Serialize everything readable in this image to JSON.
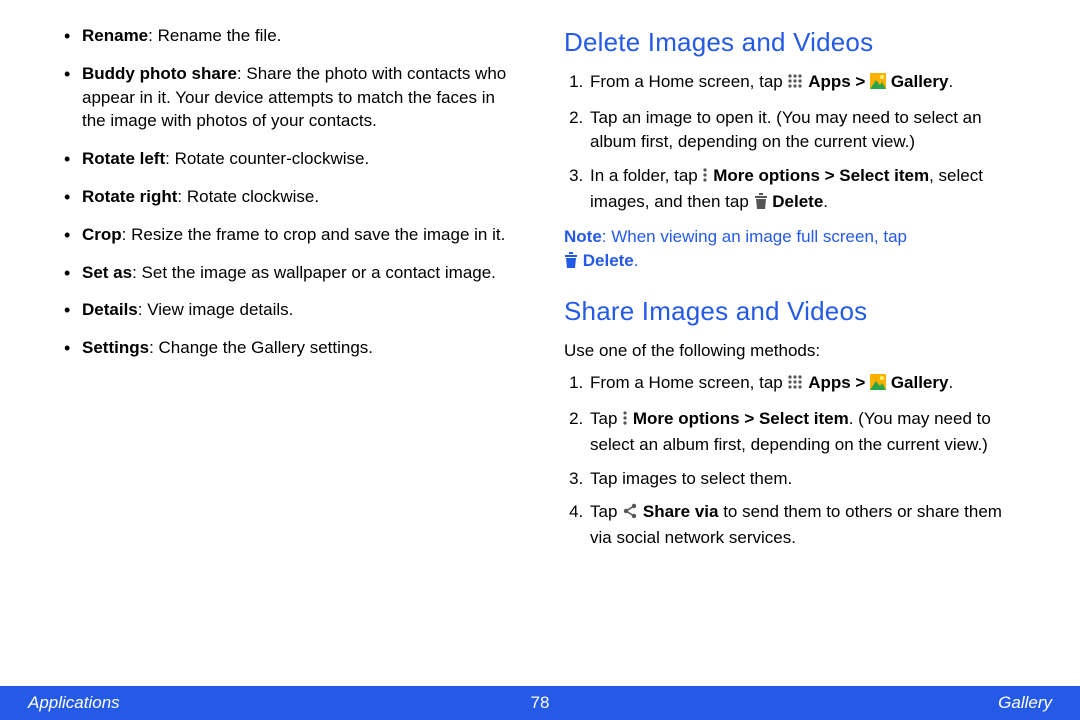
{
  "left": {
    "items": [
      {
        "label": "Rename",
        "desc": ": Rename the file."
      },
      {
        "label": "Buddy photo share",
        "desc": ": Share the photo with contacts who appear in it. Your device attempts to match the faces in the image with photos of your contacts."
      },
      {
        "label": "Rotate left",
        "desc": ": Rotate counter-clockwise."
      },
      {
        "label": "Rotate right",
        "desc": ": Rotate clockwise."
      },
      {
        "label": "Crop",
        "desc": ": Resize the frame to crop and save the image in it."
      },
      {
        "label": "Set as",
        "desc": ": Set the image as wallpaper or a contact image."
      },
      {
        "label": "Details",
        "desc": ": View image details."
      },
      {
        "label": "Settings",
        "desc": ": Change the Gallery settings."
      }
    ]
  },
  "right": {
    "delete": {
      "heading": "Delete Images and Videos",
      "step1_a": "From a Home screen, tap ",
      "step1_b": " Apps > ",
      "step1_c": " Gallery",
      "step1_d": ".",
      "step2": "Tap an image to open it. (You may need to select an album first, depending on the current view.)",
      "step3_a": "In a folder, tap ",
      "step3_b": " More options > Select item",
      "step3_c": ", select images, and then tap ",
      "step3_d": " Delete",
      "step3_e": ".",
      "note_a": "Note",
      "note_b": ": When viewing an image full screen, tap ",
      "note_c": " Delete",
      "note_d": "."
    },
    "share": {
      "heading": "Share Images and Videos",
      "intro": "Use one of the following methods:",
      "step1_a": "From a Home screen, tap ",
      "step1_b": " Apps > ",
      "step1_c": " Gallery",
      "step1_d": ".",
      "step2_a": "Tap ",
      "step2_b": " More options > Select item",
      "step2_c": ". (You may need to select an album first, depending on the current view.)",
      "step3": "Tap images to select them.",
      "step4_a": "Tap ",
      "step4_b": " Share via",
      "step4_c": " to send them to others or share them via social network services."
    }
  },
  "footer": {
    "left": "Applications",
    "center": "78",
    "right": "Gallery"
  }
}
